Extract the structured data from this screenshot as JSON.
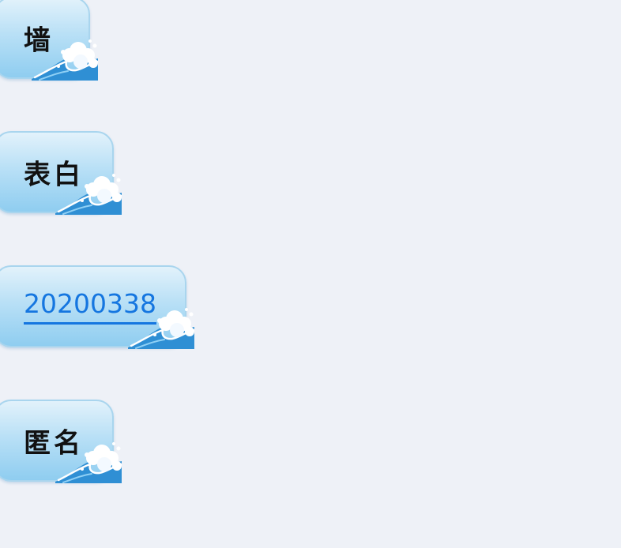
{
  "messages": [
    {
      "text": "墙"
    },
    {
      "text": "表白"
    },
    {
      "text": "20200338"
    },
    {
      "text": "匿名"
    }
  ]
}
